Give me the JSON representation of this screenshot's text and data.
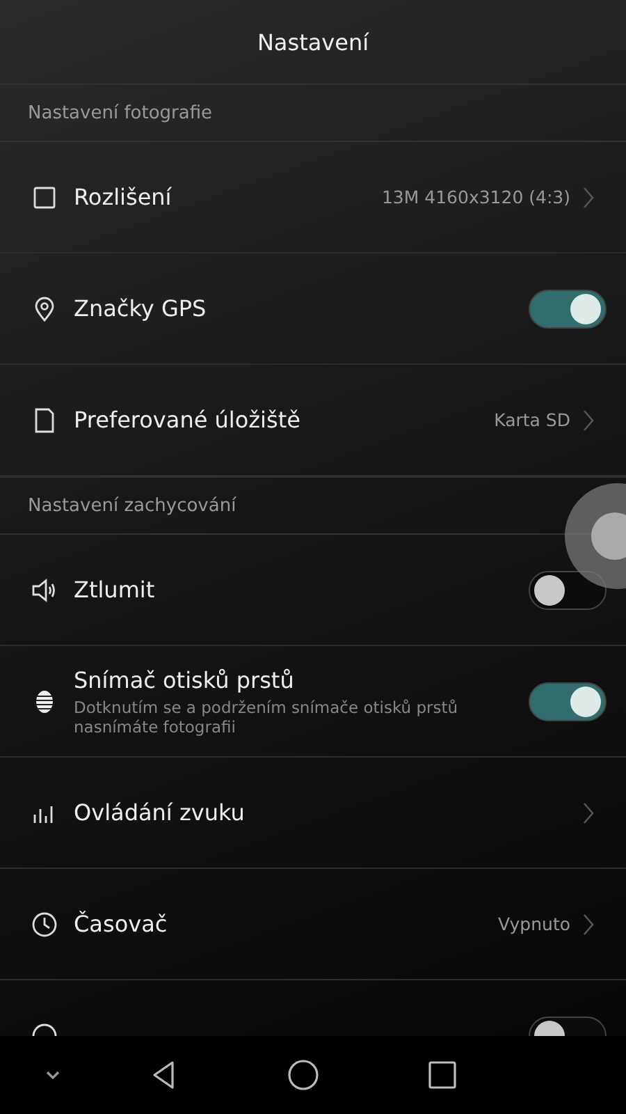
{
  "header": {
    "title": "Nastavení"
  },
  "sections": [
    {
      "title": "Nastavení fotografie",
      "items": [
        {
          "kind": "value",
          "label": "Rozlišení",
          "value": "13M 4160x3120 (4:3)"
        },
        {
          "kind": "toggle",
          "label": "Značky GPS",
          "on": true
        },
        {
          "kind": "value",
          "label": "Preferované úložiště",
          "value": "Karta SD"
        }
      ]
    },
    {
      "title": "Nastavení zachycování",
      "items": [
        {
          "kind": "toggle",
          "label": "Ztlumit",
          "on": false
        },
        {
          "kind": "toggle",
          "label": "Snímač otisků prstů",
          "description": "Dotknutím se a podržením snímače otisků prstů nasnímáte fotografii",
          "on": true
        },
        {
          "kind": "link",
          "label": "Ovládání zvuku"
        },
        {
          "kind": "value",
          "label": "Časovač",
          "value": "Vypnuto"
        },
        {
          "kind": "toggle",
          "on": false
        }
      ]
    }
  ]
}
